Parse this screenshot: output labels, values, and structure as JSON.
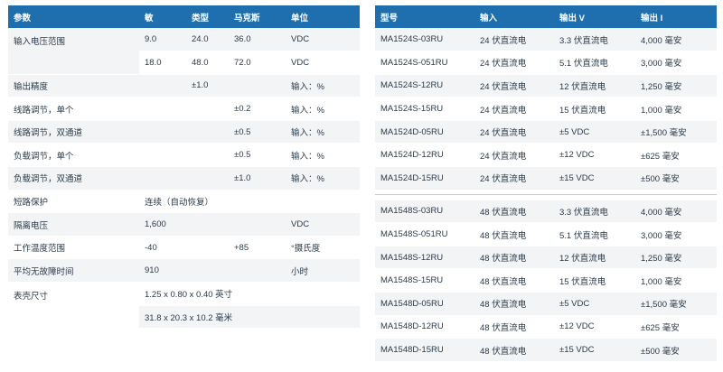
{
  "left_table": {
    "headers": [
      "参数",
      "敏",
      "类型",
      "马克斯",
      "单位"
    ],
    "rows": [
      [
        "输入电压范围",
        "9.0",
        "24.0",
        "36.0",
        "VDC"
      ],
      [
        "",
        "18.0",
        "48.0",
        "72.0",
        "VDC"
      ],
      [
        "输出精度",
        "",
        "±1.0",
        "",
        "输入：%"
      ],
      [
        "线路调节，单个",
        "",
        "",
        "±0.2",
        "输入：%"
      ],
      [
        "线路调节，双通道",
        "",
        "",
        "±0.5",
        "输入：%"
      ],
      [
        "负载调节，单个",
        "",
        "",
        "±0.5",
        "输入：%"
      ],
      [
        "负载调节，双通道",
        "",
        "",
        "±1.0",
        "输入：%"
      ],
      [
        "短路保护",
        "连续（自动恢复）",
        "",
        "",
        ""
      ],
      [
        "隔离电压",
        "1,600",
        "",
        "",
        "VDC"
      ],
      [
        "工作温度范围",
        "-40",
        "",
        "+85",
        "°摄氏度"
      ],
      [
        "平均无故障时间",
        "910",
        "",
        "",
        "小时"
      ],
      [
        "表壳尺寸",
        "1.25 x 0.80 x 0.40 英寸",
        "",
        "",
        ""
      ],
      [
        "",
        "31.8 x 20.3 x 10.2 毫米",
        "",
        "",
        ""
      ]
    ]
  },
  "right_table": {
    "headers": [
      "型号",
      "输入",
      "输出 V",
      "输出 I"
    ],
    "group1": [
      [
        "MA1524S-03RU",
        "24 伏直流电",
        "3.3 伏直流电",
        "4,000 毫安"
      ],
      [
        "MA1524S-051RU",
        "24 伏直流电",
        "5.1 伏直流电",
        "3,000 毫安"
      ],
      [
        "MA1524S-12RU",
        "24 伏直流电",
        "12 伏直流电",
        "1,250 毫安"
      ],
      [
        "MA1524S-15RU",
        "24 伏直流电",
        "15 伏直流电",
        "1,000 毫安"
      ],
      [
        "MA1524D-05RU",
        "24 伏直流电",
        "±5 VDC",
        "±1,500 毫安"
      ],
      [
        "MA1524D-12RU",
        "24 伏直流电",
        "±12 VDC",
        "±625 毫安"
      ],
      [
        "MA1524D-15RU",
        "24 伏直流电",
        "±15 VDC",
        "±500 毫安"
      ]
    ],
    "group2": [
      [
        "MA1548S-03RU",
        "48 伏直流电",
        "3.3 伏直流电",
        "4,000 毫安"
      ],
      [
        "MA1548S-051RU",
        "48 伏直流电",
        "5.1 伏直流电",
        "3,000 毫安"
      ],
      [
        "MA1548S-12RU",
        "48 伏直流电",
        "12 伏直流电",
        "1,250 毫安"
      ],
      [
        "MA1548S-15RU",
        "48 伏直流电",
        "15 伏直流电",
        "1,000 毫安"
      ],
      [
        "MA1548D-05RU",
        "48 伏直流电",
        "±5 VDC",
        "±1,500 毫安"
      ],
      [
        "MA1548D-12RU",
        "48 伏直流电",
        "±12 VDC",
        "±625 毫安"
      ],
      [
        "MA1548D-15RU",
        "48 伏直流电",
        "±15 VDC",
        "±500 毫安"
      ]
    ]
  }
}
